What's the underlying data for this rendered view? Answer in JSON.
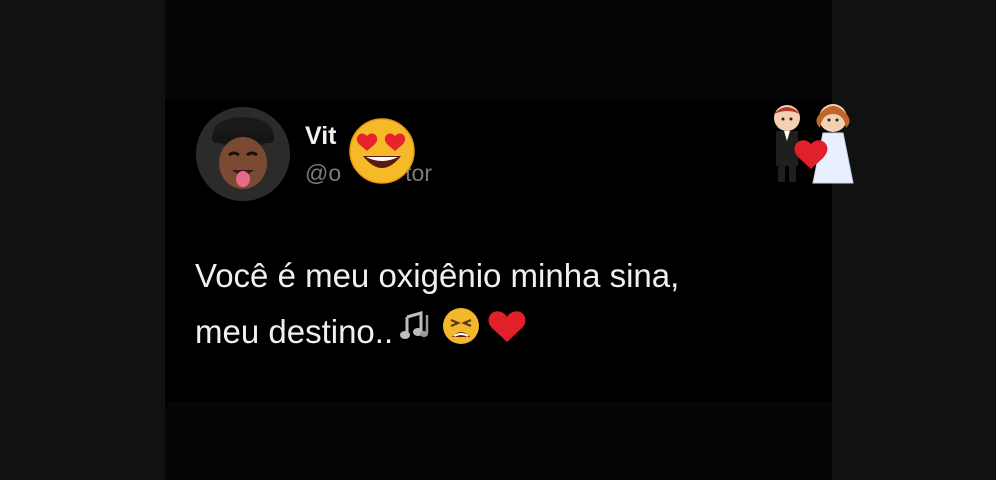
{
  "tweet": {
    "name": "Vit",
    "handle": "@o",
    "handle_end": "tor",
    "text_line1": "Você é meu oxigênio minha sina,",
    "text_line2": "meu destino.."
  },
  "icons": {
    "avatar": "memoji-avatar-icon",
    "face_sticker": "heart-eyes-emoji-icon",
    "couple_sticker": "couple-heart-sticker-icon",
    "music": "music-notes-icon",
    "tired": "tired-face-emoji-icon",
    "heart": "red-heart-icon"
  },
  "colors": {
    "background": "#000000",
    "name": "#f2f2f2",
    "handle": "#7a7a7a",
    "text": "#f0f0f0",
    "heart": "#e0202a"
  }
}
